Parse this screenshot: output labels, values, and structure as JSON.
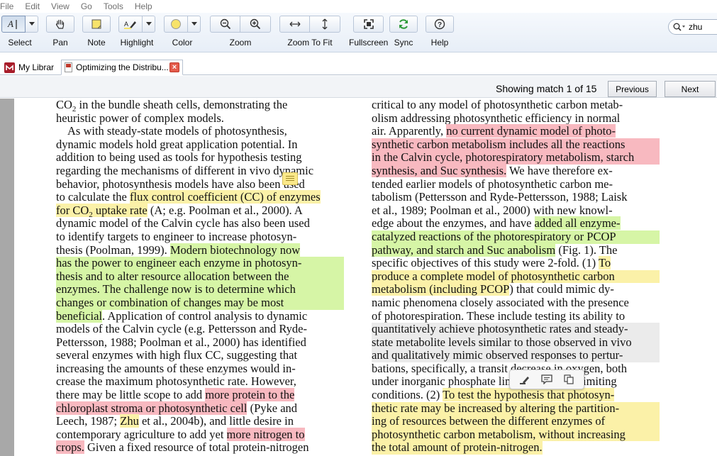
{
  "menu": [
    "File",
    "Edit",
    "View",
    "Go",
    "Tools",
    "Help"
  ],
  "toolbar": {
    "select": "Select",
    "pan": "Pan",
    "note": "Note",
    "highlight": "Highlight",
    "color": "Color",
    "zoom": "Zoom",
    "zoom_to_fit": "Zoom To Fit",
    "fullscreen": "Fullscreen",
    "sync": "Sync",
    "help": "Help",
    "highlight_color": "#f7e36b",
    "color_swatch": "#f7e36b",
    "search_value": "zhu"
  },
  "tabs": [
    {
      "label": "My Library",
      "icon": "mendeley-library-icon"
    },
    {
      "label": "Optimizing the Distribu...",
      "icon": "pdf-document-icon"
    }
  ],
  "findbar": {
    "match_text": "Showing match 1 of 15",
    "previous": "Previous",
    "next": "Next"
  },
  "colors": {
    "yellow_highlight": "#fbf1a8",
    "red_highlight": "#f8b9c0",
    "green_highlight": "#d6f5a6",
    "selection": "#ebebeb",
    "gutter": "#a8a8a8"
  },
  "doc": {
    "left": {
      "l1a": "CO",
      "l1sub": "2",
      "l1b": " in the bundle sheath cells, demonstrating the",
      "l2": "heuristic power of complex models.",
      "l3": "As with steady-state models of photosynthesis,",
      "l4": "dynamic models hold great application potential. In",
      "l5": "addition to being used as tools for hypothesis testing",
      "l6": "regarding the mechanisms of different in vivo dynamic",
      "l7": "behavior, photosynthesis models have also been used",
      "l8a": "to calculate the ",
      "l8b": "flux control coefficient (CC) of enzymes",
      "l9a": "for CO",
      "l9sub": "2",
      "l9b": " uptake rate",
      "l9c": " (A; e.g. Poolman et al., 2000). A",
      "l10": "dynamic model of the Calvin cycle has also been used",
      "l11": "to identify targets to engineer to increase photosyn-",
      "l12a": "thesis (Poolman, 1999). ",
      "l12b": "Modern biotechnology now",
      "l13": "has the power to engineer each enzyme in photosyn-",
      "l14": "thesis and to alter resource allocation between the",
      "l15": "enzymes. The challenge now is to determine which",
      "l16": "changes or combination of changes may be most",
      "l17a": "beneficial",
      "l17b": ". Application of control analysis to dynamic",
      "l18": "models of the Calvin cycle (e.g. Pettersson and Ryde-",
      "l19": "Pettersson, 1988; Poolman et al., 2000) has identified",
      "l20": "several enzymes with high flux CC, suggesting that",
      "l21": "increasing the amounts of these enzymes would in-",
      "l22": "crease the maximum photosynthetic rate. However,",
      "l23a": "there may be little scope to add ",
      "l23b": "more protein to the",
      "l24a": "chloroplast stroma or photosynthetic cell",
      "l24b": " (Pyke and",
      "l25a": "Leech, 1987; ",
      "l25b": "Zhu",
      "l25c": " et al., 2004b), and little desire in",
      "l26a": "contemporary agriculture to add yet ",
      "l26b": "more nitrogen to",
      "l27a": "crops.",
      "l27b": " Given a fixed resource of total protein-nitrogen"
    },
    "right": {
      "r1": "critical to any model of photosynthetic carbon metab-",
      "r2": "olism addressing photosynthetic efficiency in normal",
      "r3a": "air. Apparently, ",
      "r3b": "no current dynamic model of photo-",
      "r4": "synthetic carbon metabolism includes all the reactions",
      "r5": "in the Calvin cycle, photorespiratory metabolism, starch",
      "r6a": "synthesis, and Suc synthesis.",
      "r6b": " We have therefore ex-",
      "r7": "tended earlier models of photosynthetic carbon me-",
      "r8": "tabolism (Pettersson and Ryde-Pettersson, 1988; Laisk",
      "r9": "et al., 1989; Poolman et al., 2000) with new knowl-",
      "r10a": "edge about the enzymes, and have ",
      "r10b": "added all enzyme-",
      "r11": "catalyzed reactions of the photorespiratory or PCOP",
      "r12a": "pathway, and starch and Suc anabolism",
      "r12b": " (Fig. 1). The",
      "r13a": "specific objectives of this study were 2-fold. (1) ",
      "r13b": "To",
      "r14": "produce a complete model of photosynthetic carbon",
      "r15a": "metabolism (including PCOP",
      "r15b": ") that could mimic dy-",
      "r16": "namic phenomena closely associated with the presence",
      "r17": "of photorespiration. These include testing its ability to",
      "r18": "quantitatively achieve photosynthetic rates and steady-",
      "r19": "state metabolite levels similar to those observed in vivo",
      "r20": "and qualitatively mimic observed responses to pertur-",
      "r21": "bations, specifically, a transit decrease in oxygen, both",
      "r22": "under inorganic phosphate limiting and -nonlimiting",
      "r23a": "conditions. (2) ",
      "r23b": "To test the hypothesis that photosyn-",
      "r24": "thetic rate may be increased by altering the partition-",
      "r25": "ing of resources between the different enzymes of",
      "r26": "photosynthetic carbon metabolism, without increasing",
      "r27": "the total amount of protein-nitrogen."
    }
  }
}
